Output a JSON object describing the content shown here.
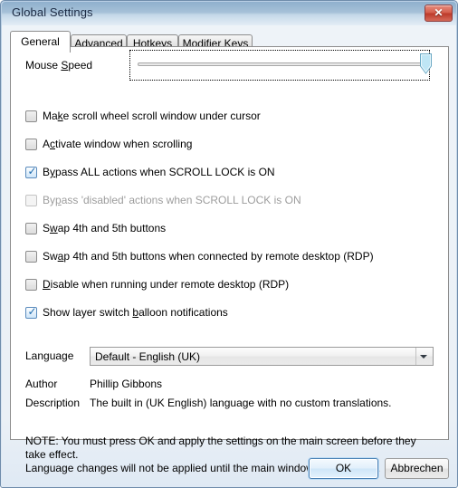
{
  "window": {
    "title": "Global Settings",
    "close_label": "✕",
    "close_icon": "close-icon"
  },
  "tabs": [
    {
      "label": "General",
      "active": true
    },
    {
      "label": "Advanced",
      "active": false
    },
    {
      "label": "Hotkeys",
      "active": false
    },
    {
      "label": "Modifier Keys",
      "active": false
    }
  ],
  "general": {
    "mouse_speed": {
      "label_pre": "Mouse ",
      "label_accel": "S",
      "label_post": "peed",
      "value_position": "max"
    },
    "checkboxes": [
      {
        "pre": "Ma",
        "accel": "k",
        "post": "e scroll wheel scroll window under cursor",
        "checked": false,
        "disabled": false
      },
      {
        "pre": "A",
        "accel": "c",
        "post": "tivate window when scrolling",
        "checked": false,
        "disabled": false
      },
      {
        "pre": "B",
        "accel": "y",
        "post": "pass ALL actions when SCROLL LOCK is ON",
        "checked": true,
        "disabled": false
      },
      {
        "pre": "By",
        "accel": "p",
        "post": "ass 'disabled' actions when SCROLL LOCK is ON",
        "checked": false,
        "disabled": true
      },
      {
        "pre": "S",
        "accel": "w",
        "post": "ap 4th and 5th buttons",
        "checked": false,
        "disabled": false
      },
      {
        "pre": "Sw",
        "accel": "a",
        "post": "p 4th and 5th buttons when connected by remote desktop (RDP)",
        "checked": false,
        "disabled": false
      },
      {
        "pre": "",
        "accel": "D",
        "post": "isable when running under remote desktop (RDP)",
        "checked": false,
        "disabled": false
      },
      {
        "pre": "Show layer switch ",
        "accel": "b",
        "post": "alloon notifications",
        "checked": true,
        "disabled": false
      }
    ],
    "language": {
      "label": "Language",
      "selected": "Default - English (UK)",
      "options": [
        "Default - English (UK)"
      ]
    },
    "author": {
      "label": "Author",
      "value": "Phillip Gibbons"
    },
    "description": {
      "label": "Description",
      "value": "The built in (UK English) language with no custom translations."
    },
    "note_line1": "NOTE: You must press OK and apply the settings on the main screen before they take effect.",
    "note_line2": "Language changes will not be applied until the main window is re-opened."
  },
  "footer": {
    "ok_label": "OK",
    "cancel_label": "Abbrechen"
  },
  "colors": {
    "accent": "#4a80b4",
    "close_red": "#bd3a2a",
    "title_blue": "#8fb0cd",
    "check_blue": "#1f6cb0"
  }
}
